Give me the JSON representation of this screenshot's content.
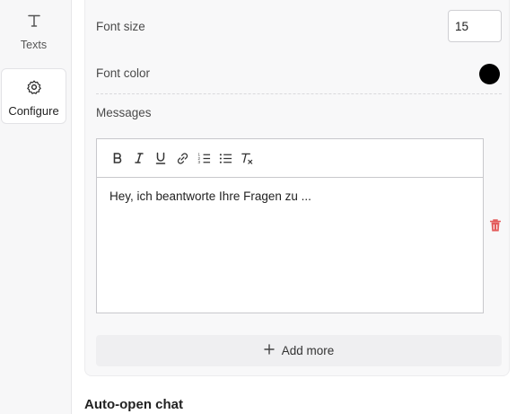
{
  "sidebar": {
    "items": [
      {
        "label": "Texts",
        "icon": "text-icon"
      },
      {
        "label": "Configure",
        "icon": "gear-icon"
      }
    ]
  },
  "settings": {
    "font_size_label": "Font size",
    "font_size_value": "15",
    "font_color_label": "Font color",
    "font_color_value": "#000000",
    "messages_label": "Messages"
  },
  "editor": {
    "toolbar": [
      "bold-icon",
      "italic-icon",
      "underline-icon",
      "link-icon",
      "ordered-list-icon",
      "bullet-list-icon",
      "clear-format-icon"
    ],
    "message_text": "Hey, ich beantworte Ihre Fragen zu ..."
  },
  "add_more_label": "Add more",
  "next_section_title": "Auto-open chat",
  "colors": {
    "delete": "#e35b5b"
  }
}
